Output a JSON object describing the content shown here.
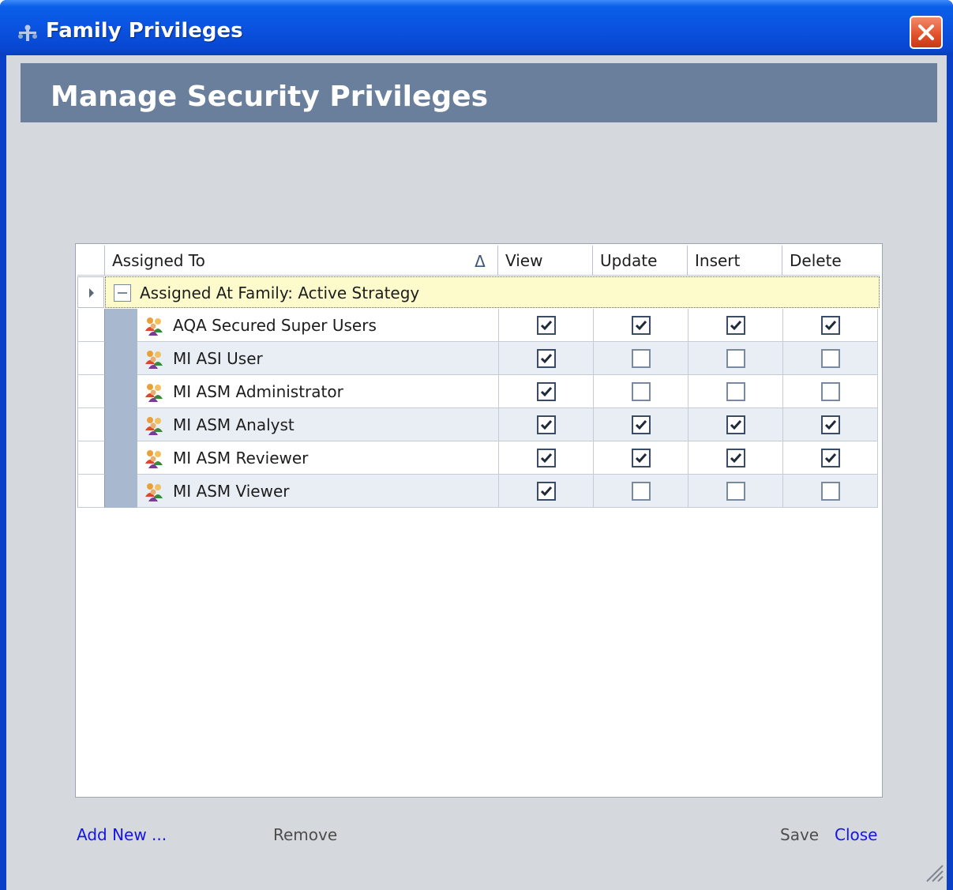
{
  "window": {
    "title": "Family Privileges",
    "close_icon": "close-icon",
    "app_icon": "family-privileges-icon"
  },
  "header": {
    "title": "Manage Security Privileges"
  },
  "grid": {
    "columns": {
      "assigned_to": "Assigned To",
      "view": "View",
      "update": "Update",
      "insert": "Insert",
      "delete": "Delete"
    },
    "sort_indicator": "Δ",
    "group": {
      "label": "Assigned At Family: Active Strategy",
      "expanded": true
    },
    "rows": [
      {
        "name": "AQA Secured Super Users",
        "view": true,
        "update": true,
        "insert": true,
        "delete": true
      },
      {
        "name": "MI ASI User",
        "view": true,
        "update": false,
        "insert": false,
        "delete": false
      },
      {
        "name": "MI ASM Administrator",
        "view": true,
        "update": false,
        "insert": false,
        "delete": false
      },
      {
        "name": "MI ASM Analyst",
        "view": true,
        "update": true,
        "insert": true,
        "delete": true
      },
      {
        "name": "MI ASM Reviewer",
        "view": true,
        "update": true,
        "insert": true,
        "delete": true
      },
      {
        "name": "MI ASM Viewer",
        "view": true,
        "update": false,
        "insert": false,
        "delete": false
      }
    ]
  },
  "footer": {
    "add_new": "Add New ...",
    "remove": "Remove",
    "save": "Save",
    "close": "Close"
  },
  "colors": {
    "titlebar": "#0a53e0",
    "banner": "#6a7f9b",
    "group_band": "#fdfbcc",
    "link": "#1414e6"
  }
}
